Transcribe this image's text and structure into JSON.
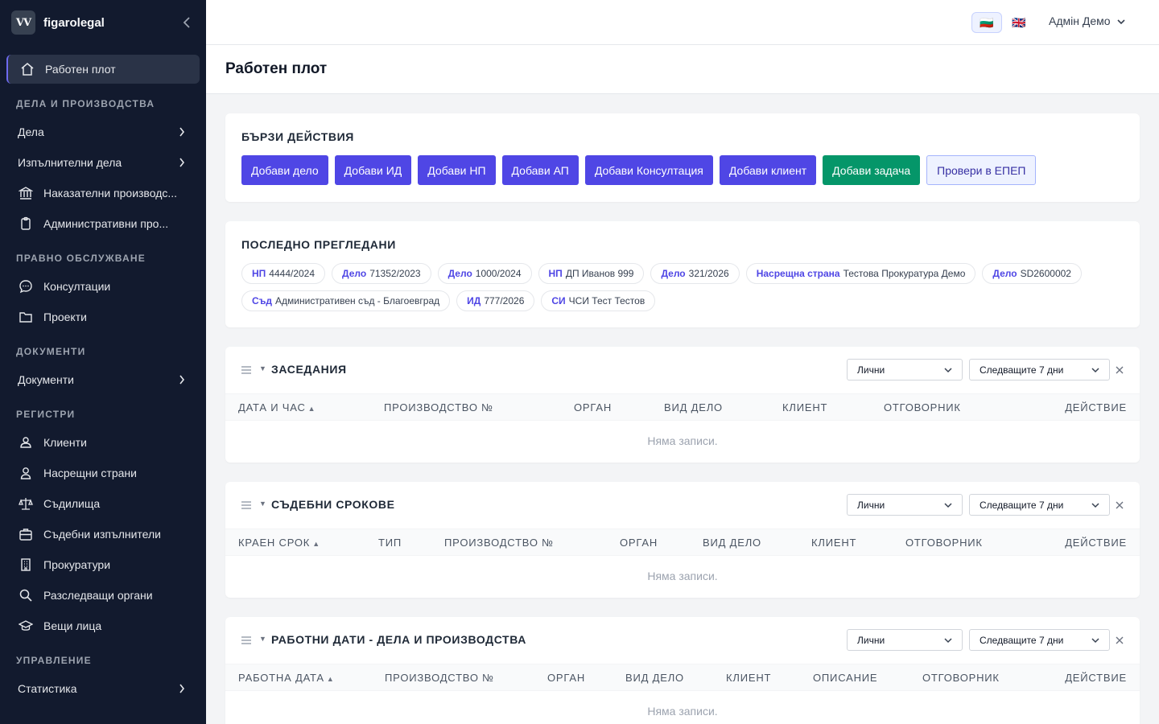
{
  "sidebar": {
    "brand": "figarolegal",
    "logo_text": "VV",
    "items": {
      "dashboard": "Работен плот",
      "cases": "Дела",
      "enforcement": "Изпълнителни дела",
      "criminal": "Наказателни производс...",
      "administrative": "Административни про...",
      "consultations": "Консултации",
      "projects": "Проекти",
      "documents": "Документи",
      "clients": "Клиенти",
      "counterparties": "Насрещни страни",
      "courts": "Съдилища",
      "bailiffs": "Съдебни изпълнители",
      "prosecutors": "Прокуратури",
      "investigators": "Разследващи органи",
      "experts": "Вещи лица",
      "statistics": "Статистика"
    },
    "sections": {
      "cases": "ДЕЛА И ПРОИЗВОДСТВА",
      "legal": "ПРАВНО ОБСЛУЖВАНЕ",
      "documents": "ДОКУМЕНТИ",
      "registers": "РЕГИСТРИ",
      "management": "УПРАВЛЕНИЕ"
    }
  },
  "topbar": {
    "flag_bg": "🇧🇬",
    "flag_en": "🇬🇧",
    "user": "Адмін Демо"
  },
  "page": {
    "title": "Работен плот"
  },
  "quick_actions": {
    "title": "БЪРЗИ ДЕЙСТВИЯ",
    "buttons": [
      "Добави дело",
      "Добави ИД",
      "Добави НП",
      "Добави АП",
      "Добави Консултация",
      "Добави клиент",
      "Добави задача",
      "Провери в ЕПЕП"
    ]
  },
  "recent": {
    "title": "ПОСЛЕДНО ПРЕГЛЕДАНИ",
    "items": [
      {
        "type": "НП",
        "value": "4444/2024"
      },
      {
        "type": "Дело",
        "value": "71352/2023"
      },
      {
        "type": "Дело",
        "value": "1000/2024"
      },
      {
        "type": "НП",
        "value": "ДП Иванов 999"
      },
      {
        "type": "Дело",
        "value": "321/2026"
      },
      {
        "type": "Насрещна страна",
        "value": "Тестова Прокуратура Демо"
      },
      {
        "type": "Дело",
        "value": "SD2600002"
      },
      {
        "type": "Съд",
        "value": "Административен съд - Благоевград"
      },
      {
        "type": "ИД",
        "value": "777/2026"
      },
      {
        "type": "СИ",
        "value": "ЧСИ Тест Тестов"
      }
    ]
  },
  "widgets": {
    "hearings": {
      "title": "ЗАСЕДАНИЯ",
      "filter1": "Лични",
      "filter2": "Следващите 7 дни",
      "columns": [
        "ДАТА И ЧАС",
        "ПРОИЗВОДСТВО №",
        "ОРГАН",
        "ВИД ДЕЛО",
        "КЛИЕНТ",
        "ОТГОВОРНИК",
        "ДЕЙСТВИЕ"
      ],
      "empty": "Няма записи."
    },
    "deadlines": {
      "title": "СЪДЕБНИ СРОКОВЕ",
      "filter1": "Лични",
      "filter2": "Следващите 7 дни",
      "columns": [
        "КРАЕН СРОК",
        "ТИП",
        "ПРОИЗВОДСТВО №",
        "ОРГАН",
        "ВИД ДЕЛО",
        "КЛИЕНТ",
        "ОТГОВОРНИК",
        "ДЕЙСТВИЕ"
      ],
      "empty": "Няма записи."
    },
    "workdates": {
      "title": "РАБОТНИ ДАТИ - ДЕЛА И ПРОИЗВОДСТВА",
      "filter1": "Лични",
      "filter2": "Следващите 7 дни",
      "columns": [
        "РАБОТНА ДАТА",
        "ПРОИЗВОДСТВО №",
        "ОРГАН",
        "ВИД ДЕЛО",
        "КЛИЕНТ",
        "ОПИСАНИЕ",
        "ОТГОВОРНИК",
        "ДЕЙСТВИЕ"
      ],
      "empty": "Няма записи."
    }
  },
  "colors": {
    "sidebar_bg": "#121a2e",
    "primary": "#4f46e5",
    "success": "#059669"
  }
}
